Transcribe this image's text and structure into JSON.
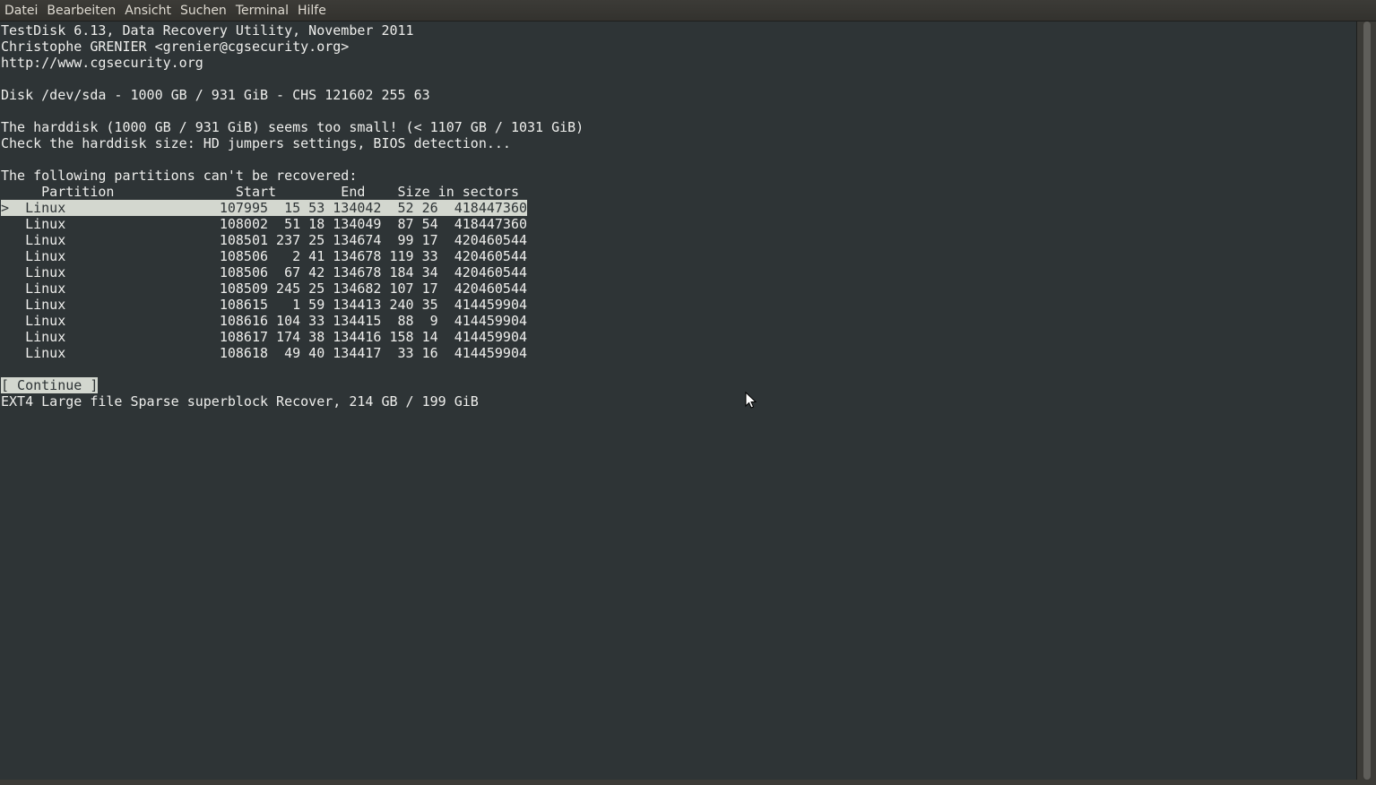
{
  "menubar": {
    "items": [
      "Datei",
      "Bearbeiten",
      "Ansicht",
      "Suchen",
      "Terminal",
      "Hilfe"
    ]
  },
  "terminal": {
    "header": [
      "TestDisk 6.13, Data Recovery Utility, November 2011",
      "Christophe GRENIER <grenier@cgsecurity.org>",
      "http://www.cgsecurity.org"
    ],
    "disk_info": "Disk /dev/sda - 1000 GB / 931 GiB - CHS 121602 255 63",
    "warning": [
      "The harddisk (1000 GB / 931 GiB) seems too small! (< 1107 GB / 1031 GiB)",
      "Check the harddisk size: HD jumpers settings, BIOS detection..."
    ],
    "partitions_title": "The following partitions can't be recovered:",
    "table_header": "     Partition               Start        End    Size in sectors",
    "rows": [
      ">  Linux                   107995  15 53 134042  52 26  418447360",
      "   Linux                   108002  51 18 134049  87 54  418447360",
      "   Linux                   108501 237 25 134674  99 17  420460544",
      "   Linux                   108506   2 41 134678 119 33  420460544",
      "   Linux                   108506  67 42 134678 184 34  420460544",
      "   Linux                   108509 245 25 134682 107 17  420460544",
      "   Linux                   108615   1 59 134413 240 35  414459904",
      "   Linux                   108616 104 33 134415  88  9  414459904",
      "   Linux                   108617 174 38 134416 158 14  414459904",
      "   Linux                   108618  49 40 134417  33 16  414459904"
    ],
    "continue_label": "[ Continue ]",
    "status_line": "EXT4 Large file Sparse superblock Recover, 214 GB / 199 GiB"
  },
  "colors": {
    "terminal_bg": "#2e3436",
    "terminal_fg": "#eeeeec",
    "highlight_bg": "#d3d7cf"
  },
  "icons": {
    "cursor": "mouse-pointer-icon"
  }
}
